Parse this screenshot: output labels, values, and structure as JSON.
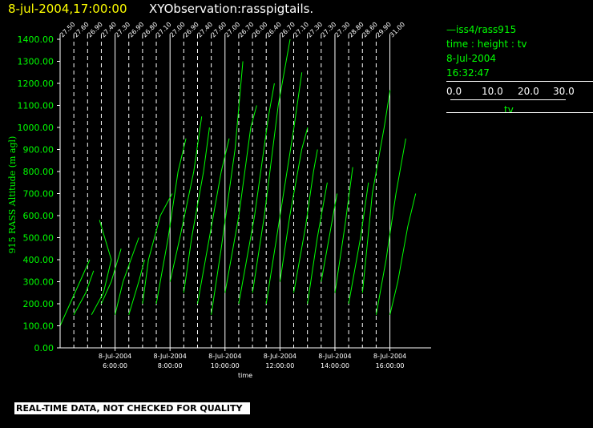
{
  "header": {
    "timestamp": "8-jul-2004,17:00:00",
    "observation": "XYObservation:rasspigtails."
  },
  "legend": {
    "line1": "—iss4/rass915",
    "line2": "time : height : tv",
    "line3": "8-Jul-2004",
    "line4": "16:32:47",
    "scale_ticks": [
      "0.0",
      "10.0",
      "20.0",
      "30.0"
    ],
    "scale_variable": "tv"
  },
  "disclaimer": "REAL-TIME DATA, NOT CHECKED FOR QUALITY",
  "colors": {
    "background": "#000000",
    "trace": "#00ff00",
    "axis": "#ffffff",
    "title": "#ffff00"
  },
  "chart_data": {
    "type": "line",
    "xlabel": "time",
    "ylabel": "915 RASS Altitude (m agl)",
    "ylim": [
      0,
      1400
    ],
    "yticks": [
      "0.00",
      "100.00",
      "200.00",
      "300.00",
      "400.00",
      "500.00",
      "600.00",
      "700.00",
      "800.00",
      "900.00",
      "1000.00",
      "1100.00",
      "1200.00",
      "1300.00",
      "1400.00"
    ],
    "xlim_hours": [
      4.0,
      17.5
    ],
    "xticks": [
      {
        "hour": 6,
        "date": "8-Jul-2004",
        "time": "6:00:00"
      },
      {
        "hour": 8,
        "date": "8-Jul-2004",
        "time": "8:00:00"
      },
      {
        "hour": 10,
        "date": "8-Jul-2004",
        "time": "10:00:00"
      },
      {
        "hour": 12,
        "date": "8-Jul-2004",
        "time": "12:00:00"
      },
      {
        "hour": 14,
        "date": "8-Jul-2004",
        "time": "14:00:00"
      },
      {
        "hour": 16,
        "date": "8-Jul-2004",
        "time": "16:00:00"
      }
    ],
    "pigtail_units_per_hour": 13.5,
    "profiles": [
      {
        "hour": 4.0,
        "label": "27.50",
        "pts": [
          [
            0,
            100
          ],
          [
            0.5,
            200
          ],
          [
            1,
            300
          ],
          [
            1.5,
            400
          ]
        ]
      },
      {
        "hour": 4.5,
        "label": "27.60",
        "pts": [
          [
            0,
            150
          ],
          [
            0.6,
            250
          ],
          [
            1.0,
            350
          ]
        ]
      },
      {
        "hour": 5.0,
        "label": "26.90",
        "pts": [
          [
            0.2,
            150
          ],
          [
            0.8,
            250
          ],
          [
            1.2,
            400
          ],
          [
            0.6,
            580
          ]
        ]
      },
      {
        "hour": 5.5,
        "label": "27.40",
        "pts": [
          [
            0,
            200
          ],
          [
            0.5,
            300
          ],
          [
            1.0,
            450
          ]
        ]
      },
      {
        "hour": 6.0,
        "label": "27.30",
        "pts": [
          [
            0,
            150
          ],
          [
            0.4,
            300
          ],
          [
            0.8,
            400
          ],
          [
            1.2,
            500
          ]
        ]
      },
      {
        "hour": 6.5,
        "label": "26.90",
        "pts": [
          [
            0,
            150
          ],
          [
            0.5,
            300
          ],
          [
            0.8,
            400
          ]
        ]
      },
      {
        "hour": 7.0,
        "label": "26.80",
        "pts": [
          [
            0,
            200
          ],
          [
            0.3,
            400
          ],
          [
            0.9,
            600
          ],
          [
            1.5,
            700
          ]
        ]
      },
      {
        "hour": 7.5,
        "label": "27.10",
        "pts": [
          [
            0,
            200
          ],
          [
            0.6,
            500
          ],
          [
            1.1,
            800
          ],
          [
            1.5,
            950
          ]
        ]
      },
      {
        "hour": 8.0,
        "label": "27.00",
        "pts": [
          [
            0,
            300
          ],
          [
            0.5,
            500
          ],
          [
            1.2,
            800
          ],
          [
            1.6,
            1050
          ]
        ]
      },
      {
        "hour": 8.5,
        "label": "26.90",
        "pts": [
          [
            0,
            250
          ],
          [
            0.4,
            500
          ],
          [
            1.0,
            800
          ],
          [
            1.3,
            1000
          ]
        ]
      },
      {
        "hour": 9.0,
        "label": "27.40",
        "pts": [
          [
            0,
            200
          ],
          [
            0.6,
            500
          ],
          [
            1.2,
            800
          ],
          [
            1.6,
            950
          ]
        ]
      },
      {
        "hour": 9.5,
        "label": "27.60",
        "pts": [
          [
            0,
            150
          ],
          [
            0.5,
            450
          ],
          [
            1.2,
            900
          ],
          [
            1.6,
            1300
          ]
        ]
      },
      {
        "hour": 10.0,
        "label": "27.00",
        "pts": [
          [
            0,
            250
          ],
          [
            0.7,
            600
          ],
          [
            1.3,
            1000
          ],
          [
            1.6,
            1100
          ]
        ]
      },
      {
        "hour": 10.5,
        "label": "26.70",
        "pts": [
          [
            0,
            200
          ],
          [
            0.8,
            600
          ],
          [
            1.5,
            1050
          ],
          [
            1.8,
            1200
          ]
        ]
      },
      {
        "hour": 11.0,
        "label": "26.00",
        "pts": [
          [
            0,
            250
          ],
          [
            0.6,
            600
          ],
          [
            1.3,
            1100
          ],
          [
            1.9,
            1400
          ]
        ]
      },
      {
        "hour": 11.5,
        "label": "26.40",
        "pts": [
          [
            0,
            200
          ],
          [
            0.7,
            600
          ],
          [
            1.4,
            1000
          ],
          [
            1.8,
            1250
          ]
        ]
      },
      {
        "hour": 12.0,
        "label": "26.70",
        "pts": [
          [
            0,
            300
          ],
          [
            0.5,
            600
          ],
          [
            1.1,
            900
          ],
          [
            1.4,
            1000
          ]
        ]
      },
      {
        "hour": 12.5,
        "label": "27.10",
        "pts": [
          [
            0,
            250
          ],
          [
            0.6,
            550
          ],
          [
            1.0,
            800
          ],
          [
            1.2,
            900
          ]
        ]
      },
      {
        "hour": 13.0,
        "label": "27.30",
        "pts": [
          [
            0,
            200
          ],
          [
            0.5,
            500
          ],
          [
            1.0,
            750
          ]
        ]
      },
      {
        "hour": 13.5,
        "label": "27.30",
        "pts": [
          [
            0,
            300
          ],
          [
            0.4,
            500
          ],
          [
            0.8,
            700
          ]
        ]
      },
      {
        "hour": 14.0,
        "label": "27.30",
        "pts": [
          [
            0,
            250
          ],
          [
            0.5,
            550
          ],
          [
            0.9,
            820
          ]
        ]
      },
      {
        "hour": 14.5,
        "label": "28.80",
        "pts": [
          [
            0,
            200
          ],
          [
            0.6,
            500
          ],
          [
            1.0,
            750
          ]
        ]
      },
      {
        "hour": 15.0,
        "label": "28.60",
        "pts": [
          [
            0,
            250
          ],
          [
            0.5,
            700
          ],
          [
            1.1,
            1000
          ],
          [
            1.4,
            1170
          ]
        ]
      },
      {
        "hour": 15.5,
        "label": "29.90",
        "pts": [
          [
            0,
            150
          ],
          [
            0.5,
            400
          ],
          [
            1.0,
            700
          ],
          [
            1.5,
            950
          ]
        ]
      },
      {
        "hour": 16.0,
        "label": "31.00",
        "pts": [
          [
            0,
            150
          ],
          [
            0.4,
            300
          ],
          [
            0.9,
            550
          ],
          [
            1.3,
            700
          ]
        ]
      }
    ]
  }
}
